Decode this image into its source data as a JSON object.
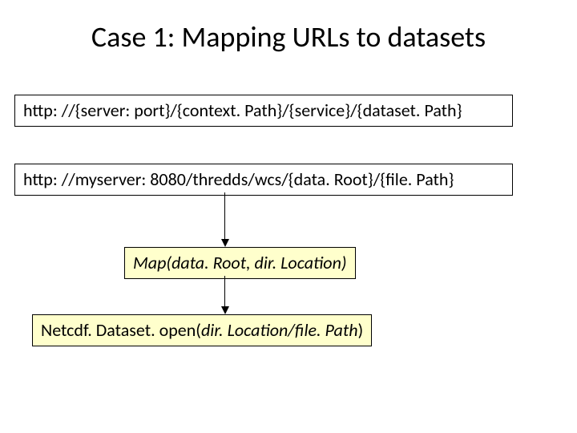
{
  "title": "Case 1: Mapping URLs to datasets",
  "box1": "http: //{server: port}/{context. Path}/{service}/{dataset. Path}",
  "box2": "http: //myserver: 8080/thredds/wcs/{data. Root}/{file. Path}",
  "box3": "Map(data. Root, dir. Location)",
  "box4": "Netcdf. Dataset. open(dir. Location/file. Path)"
}
